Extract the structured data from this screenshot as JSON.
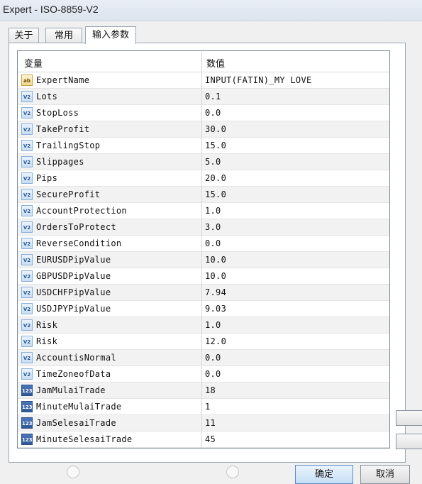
{
  "window": {
    "title": "Expert - ISO-8859-V2"
  },
  "tabs": [
    {
      "label": "关于"
    },
    {
      "label": "常用"
    },
    {
      "label": "输入参数"
    }
  ],
  "table": {
    "headers": {
      "variable": "变量",
      "value": "数值"
    },
    "rows": [
      {
        "icon": "ab",
        "name": "ExpertName",
        "value": "INPUT(FATIN)_MY LOVE"
      },
      {
        "icon": "v2",
        "name": "Lots",
        "value": "0.1"
      },
      {
        "icon": "v2",
        "name": "StopLoss",
        "value": "0.0"
      },
      {
        "icon": "v2",
        "name": "TakeProfit",
        "value": "30.0"
      },
      {
        "icon": "v2",
        "name": "TrailingStop",
        "value": "15.0"
      },
      {
        "icon": "v2",
        "name": "Slippages",
        "value": "5.0"
      },
      {
        "icon": "v2",
        "name": "Pips",
        "value": "20.0"
      },
      {
        "icon": "v2",
        "name": "SecureProfit",
        "value": "15.0"
      },
      {
        "icon": "v2",
        "name": "AccountProtection",
        "value": "1.0"
      },
      {
        "icon": "v2",
        "name": "OrdersToProtect",
        "value": "3.0"
      },
      {
        "icon": "v2",
        "name": "ReverseCondition",
        "value": "0.0"
      },
      {
        "icon": "v2",
        "name": "EURUSDPipValue",
        "value": "10.0"
      },
      {
        "icon": "v2",
        "name": "GBPUSDPipValue",
        "value": "10.0"
      },
      {
        "icon": "v2",
        "name": "USDCHFPipValue",
        "value": "7.94"
      },
      {
        "icon": "v2",
        "name": "USDJPYPipValue",
        "value": "9.03"
      },
      {
        "icon": "v2",
        "name": "Risk",
        "value": "1.0"
      },
      {
        "icon": "v2",
        "name": "Risk",
        "value": "12.0"
      },
      {
        "icon": "v2",
        "name": "AccountisNormal",
        "value": "0.0"
      },
      {
        "icon": "v2",
        "name": "TimeZoneofData",
        "value": "0.0"
      },
      {
        "icon": "123",
        "name": "JamMulaiTrade",
        "value": "18"
      },
      {
        "icon": "123",
        "name": "MinuteMulaiTrade",
        "value": "1"
      },
      {
        "icon": "123",
        "name": "JamSelesaiTrade",
        "value": "11"
      },
      {
        "icon": "123",
        "name": "MinuteSelesaiTrade",
        "value": "45"
      }
    ]
  },
  "buttons": {
    "ok": "确定",
    "cancel": "取消"
  },
  "icon_names": {
    "ab": "string-type-icon",
    "v2": "double-type-icon",
    "123": "integer-type-icon"
  }
}
